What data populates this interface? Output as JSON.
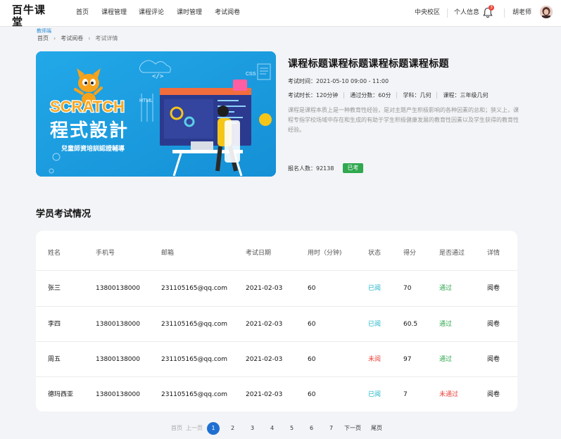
{
  "header": {
    "logo_title": "百牛课堂",
    "logo_sub": "教师端",
    "nav": [
      "首页",
      "课程管理",
      "课程评论",
      "课时管理",
      "考试阅卷"
    ],
    "campus": "中央校区",
    "profile": "个人信息",
    "notification_count": "3",
    "teacher": "胡老师"
  },
  "breadcrumb": [
    "首页",
    "考试阅卷",
    "考试详情"
  ],
  "course": {
    "title": "课程标题课程标题课程标题课程标题",
    "exam_time": "考试时间：2021-05-10 09:00 - 11:00",
    "duration": "考试时长：120分钟",
    "pass_score": "通过分数：60分",
    "subject": "学科：几何",
    "course": "课程：三年级几何",
    "description": "课程是课程本质上是一种教育性经验，是对主题产生积极影响的各种因素的总和；狭义上，课程专指学校场域中存在和生成的有助于学生积极健康发展的教育性因素以及学生获得的教育性经验。",
    "enroll": "报名人数：92138",
    "status_badge": "已考"
  },
  "banner": {
    "logo_text": "SCRATCH",
    "title": "程式設計",
    "subtitle": "兒童師資培訓認證輔導",
    "html_label": "HTML",
    "css_label": "CSS"
  },
  "section_title": "学员考试情况",
  "table": {
    "headers": [
      "姓名",
      "手机号",
      "邮箱",
      "考试日期",
      "用时（分钟)",
      "状态",
      "得分",
      "是否通过",
      "详情"
    ],
    "rows": [
      {
        "name": "张三",
        "phone": "13800138000",
        "email": "231105165@qq.com",
        "date": "2021-02-03",
        "duration": "60",
        "status": "已阅",
        "score": "70",
        "pass": "通过",
        "detail": "阅卷"
      },
      {
        "name": "李四",
        "phone": "13800138000",
        "email": "231105165@qq.com",
        "date": "2021-02-03",
        "duration": "60",
        "status": "已阅",
        "score": "60.5",
        "pass": "通过",
        "detail": "阅卷"
      },
      {
        "name": "周五",
        "phone": "13800138000",
        "email": "231105165@qq.com",
        "date": "2021-02-03",
        "duration": "60",
        "status": "未阅",
        "score": "97",
        "pass": "通过",
        "detail": "阅卷"
      },
      {
        "name": "德玛西亚",
        "phone": "13800138000",
        "email": "231105165@qq.com",
        "date": "2021-02-03",
        "duration": "60",
        "status": "已阅",
        "score": "7",
        "pass": "未通过",
        "detail": "阅卷"
      }
    ]
  },
  "pagination": {
    "first": "首页",
    "prev": "上一页",
    "pages": [
      "1",
      "2",
      "3",
      "4",
      "5",
      "6",
      "7"
    ],
    "current": "1",
    "next": "下一页",
    "last": "尾页"
  }
}
